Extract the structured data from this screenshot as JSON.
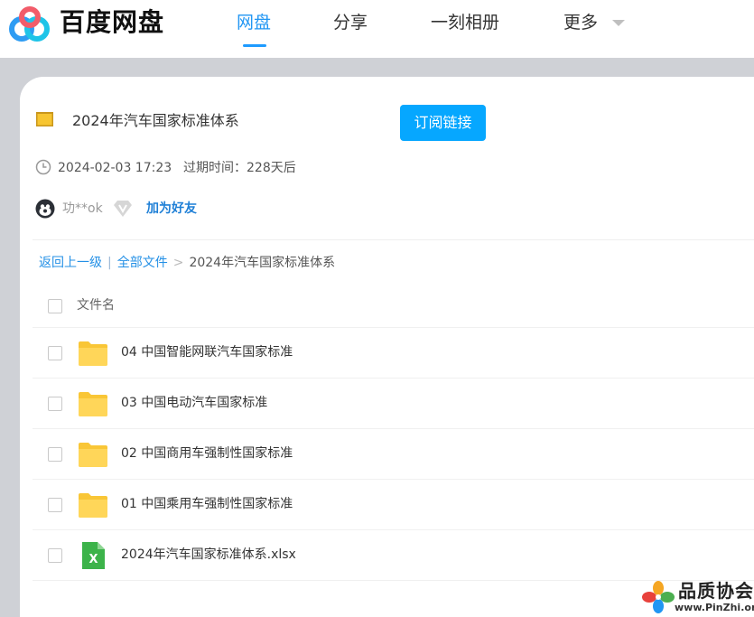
{
  "header": {
    "brand": "百度网盘",
    "nav": [
      {
        "label": "网盘",
        "active": true
      },
      {
        "label": "分享",
        "active": false
      },
      {
        "label": "一刻相册",
        "active": false
      },
      {
        "label": "更多",
        "active": false
      }
    ]
  },
  "share": {
    "title": "2024年汽车国家标准体系",
    "subscribe_label": "订阅链接",
    "date": "2024-02-03 17:23",
    "expire": "过期时间：228天后",
    "user": "功**ok",
    "add_friend": "加为好友"
  },
  "breadcrumb": {
    "back": "返回上一级",
    "separator": "|",
    "all_files": "全部文件",
    "arrow": ">",
    "current": "2024年汽车国家标准体系"
  },
  "table": {
    "header": "文件名",
    "rows": [
      {
        "name": "04 中国智能网联汽车国家标准",
        "type": "folder"
      },
      {
        "name": "03 中国电动汽车国家标准",
        "type": "folder"
      },
      {
        "name": "02 中国商用车强制性国家标准",
        "type": "folder"
      },
      {
        "name": "01 中国乘用车强制性国家标准",
        "type": "folder"
      },
      {
        "name": "2024年汽车国家标准体系.xlsx",
        "type": "excel"
      }
    ]
  },
  "watermark": {
    "text": "品质协会",
    "url": "www.PinZhi.org"
  },
  "colors": {
    "accent": "#06a7ff",
    "nav_active": "#2196f3",
    "link": "#2490e6",
    "folder": "#ffd24d",
    "excel": "#3cb34a",
    "backdrop": "#cfd1d6"
  }
}
